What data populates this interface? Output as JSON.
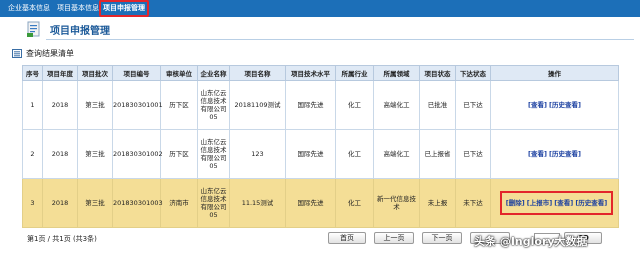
{
  "nav": {
    "tabs": [
      {
        "label": "企业基本信息"
      },
      {
        "label": "项目基本信息"
      },
      {
        "label": "项目申报管理"
      }
    ]
  },
  "page": {
    "title": "项目申报管理",
    "result_label": "查询结果清单"
  },
  "table": {
    "headers": [
      "序号",
      "项目年度",
      "项目批次",
      "项目编号",
      "审核单位",
      "企业名称",
      "项目名称",
      "项目技术水平",
      "所属行业",
      "所属领域",
      "项目状态",
      "下达状态",
      "操作"
    ],
    "rows": [
      {
        "no": "1",
        "year": "2018",
        "batch": "第三批",
        "code": "201830301001",
        "unit": "历下区",
        "company": "山东亿云信息技术有限公司05",
        "name": "20181109测试",
        "tech": "国际先进",
        "industry": "化工",
        "field": "高端化工",
        "status": "已批准",
        "issue": "已下达",
        "actions": [
          "[查看]",
          "[历史查看]"
        ],
        "highlight": false
      },
      {
        "no": "2",
        "year": "2018",
        "batch": "第三批",
        "code": "201830301002",
        "unit": "历下区",
        "company": "山东亿云信息技术有限公司05",
        "name": "123",
        "tech": "国际先进",
        "industry": "化工",
        "field": "高端化工",
        "status": "已上报省",
        "issue": "已下达",
        "actions": [
          "[查看]",
          "[历史查看]"
        ],
        "highlight": false
      },
      {
        "no": "3",
        "year": "2018",
        "batch": "第三批",
        "code": "201830301003",
        "unit": "济南市",
        "company": "山东亿云信息技术有限公司05",
        "name": "11.15测试",
        "tech": "国际先进",
        "industry": "化工",
        "field": "新一代信息技术",
        "status": "未上报",
        "issue": "未下达",
        "actions": [
          "[删除]",
          "[上报市]",
          "[查看]",
          "[历史查看]"
        ],
        "highlight": true
      }
    ]
  },
  "pagination": {
    "info": "第1页 / 共1页 (共3条)",
    "first": "首页",
    "prev": "上一页",
    "next": "下一页",
    "go": "GO"
  },
  "watermark": "头条 @Inglory大数据",
  "colors": {
    "nav_bg": "#1c6fb8",
    "header_bg": "#dfe9f5",
    "highlight_row": "#f4de96",
    "highlight_border": "#e3262b",
    "action_link": "#1a3fa0",
    "status_green": "#2d9a2d"
  },
  "icons": {
    "title": "document-icon",
    "result": "list-icon"
  }
}
